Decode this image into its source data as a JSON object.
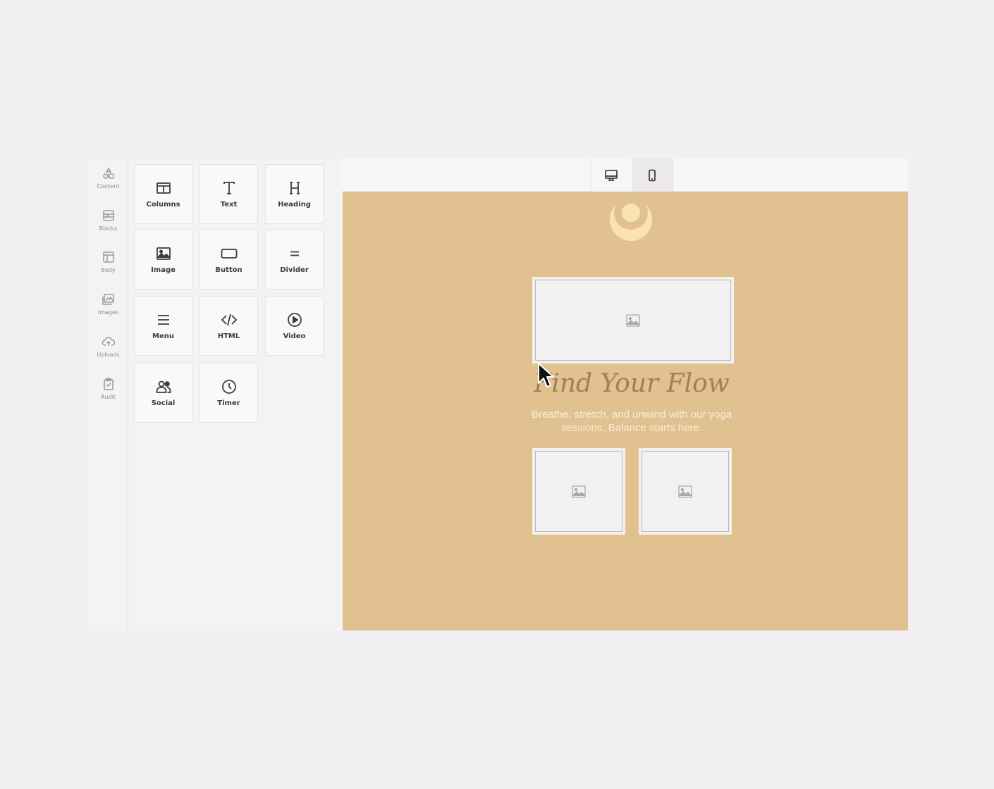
{
  "sidebar": {
    "items": [
      {
        "label": "Content",
        "icon": "shapes-icon"
      },
      {
        "label": "Blocks",
        "icon": "blocks-icon"
      },
      {
        "label": "Body",
        "icon": "layout-icon"
      },
      {
        "label": "Images",
        "icon": "images-icon"
      },
      {
        "label": "Uploads",
        "icon": "cloud-upload-icon"
      },
      {
        "label": "Audit",
        "icon": "clipboard-check-icon"
      }
    ]
  },
  "tools": {
    "items": [
      {
        "label": "Columns",
        "icon": "columns-icon"
      },
      {
        "label": "Text",
        "icon": "text-icon"
      },
      {
        "label": "Heading",
        "icon": "heading-icon"
      },
      {
        "label": "Image",
        "icon": "image-icon"
      },
      {
        "label": "Button",
        "icon": "button-icon"
      },
      {
        "label": "Divider",
        "icon": "divider-icon"
      },
      {
        "label": "Menu",
        "icon": "menu-icon"
      },
      {
        "label": "HTML",
        "icon": "code-icon"
      },
      {
        "label": "Video",
        "icon": "play-circle-icon"
      },
      {
        "label": "Social",
        "icon": "users-icon"
      },
      {
        "label": "Timer",
        "icon": "clock-icon"
      }
    ]
  },
  "toolbar": {
    "desktop_icon": "desktop-icon",
    "mobile_icon": "mobile-icon",
    "active_view": "mobile"
  },
  "email": {
    "headline": "Find Your Flow",
    "subtext": "Breathe, stretch, and unwind with our yoga sessions. Balance starts here.",
    "logo_icon": "moon-logo-icon",
    "background_color": "#e1c18f",
    "headline_color": "#9f7f5c",
    "subtext_color": "#f6edd8"
  }
}
